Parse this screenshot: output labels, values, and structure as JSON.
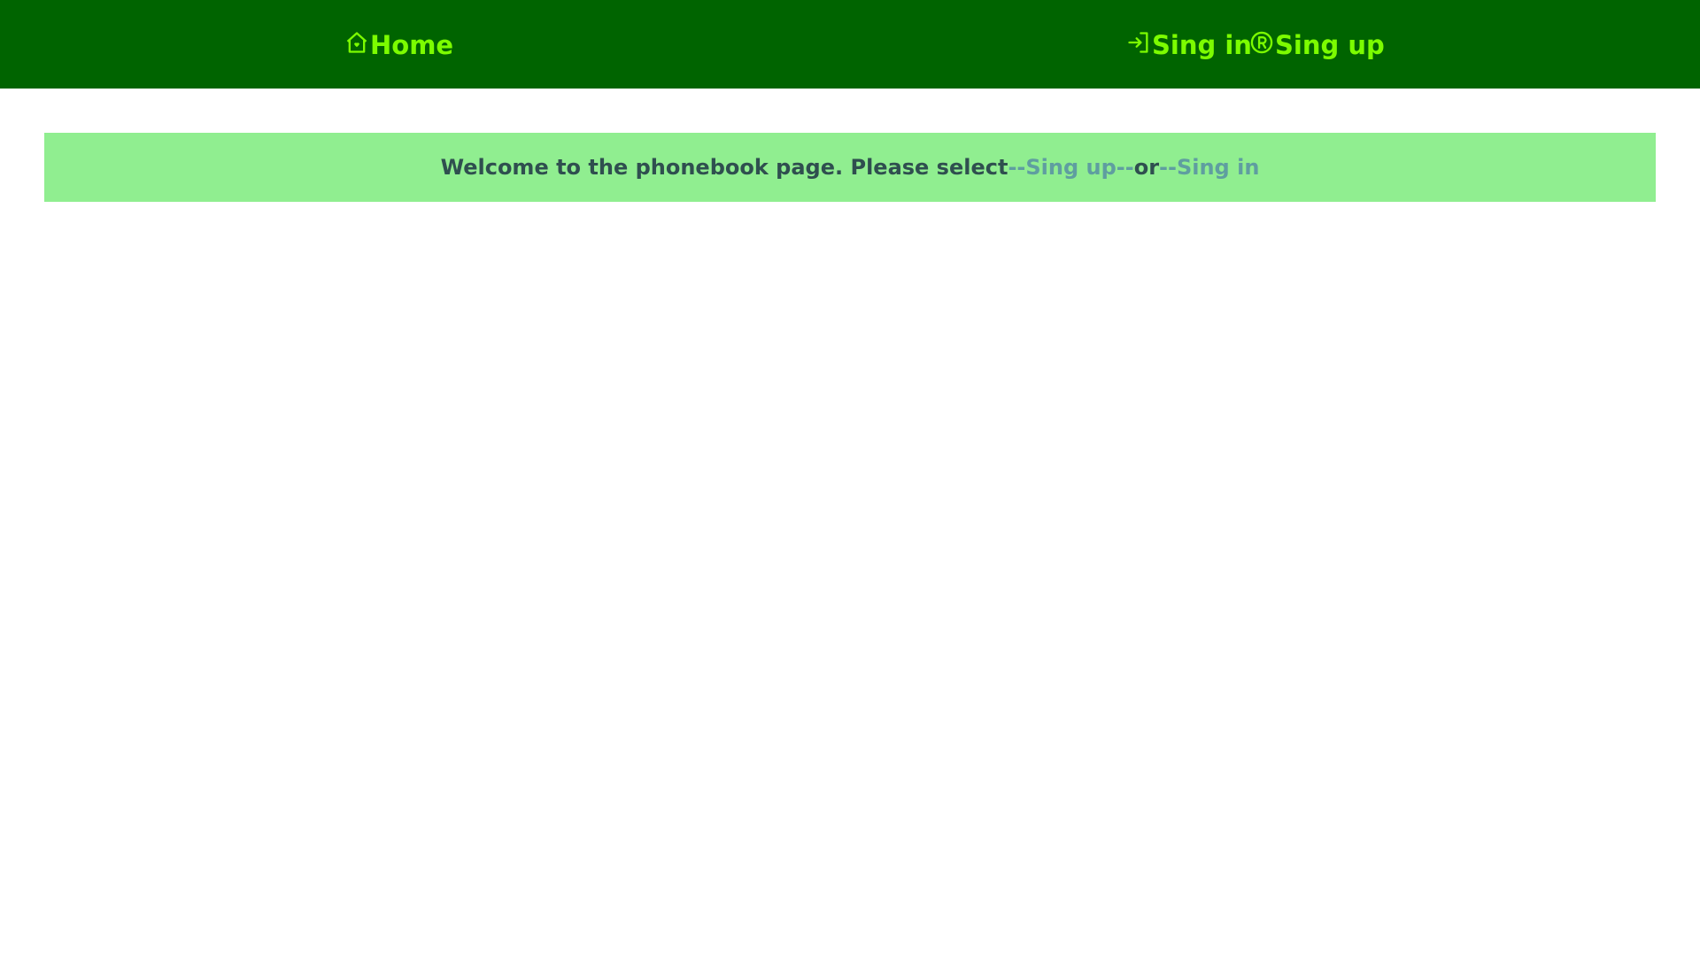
{
  "nav": {
    "home_label": "Home",
    "signin_label": "Sing in",
    "signup_label": "Sing up",
    "icons": {
      "home": "home-icon",
      "signin": "login-icon",
      "signup": "registered-icon"
    }
  },
  "banner": {
    "text": "Welcome to the phonebook page. Please select",
    "signup_link": "--Sing up--",
    "or_text": "or",
    "signin_link": "--Sing in"
  },
  "colors": {
    "header_bg": "#006400",
    "nav_text": "#7cfc00",
    "banner_bg": "#90ee90",
    "banner_text": "#2f4f4f",
    "banner_link": "#5f9ea0"
  }
}
